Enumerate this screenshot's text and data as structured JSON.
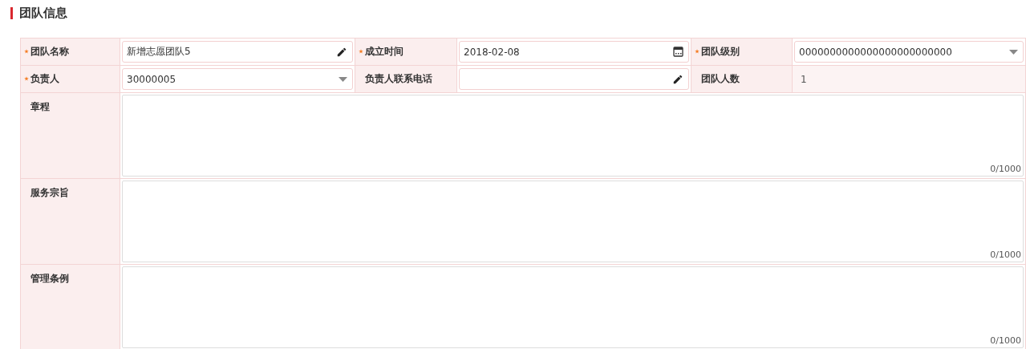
{
  "section_title": "团队信息",
  "rows": [
    [
      {
        "label": "团队名称",
        "required": true,
        "field": {
          "kind": "text",
          "value": "新增志愿团队5"
        }
      },
      {
        "label": "成立时间",
        "required": true,
        "field": {
          "kind": "date",
          "value": "2018-02-08"
        }
      },
      {
        "label": "团队级别",
        "required": true,
        "field": {
          "kind": "select",
          "value": "0000000000000000000000000"
        }
      }
    ],
    [
      {
        "label": "负责人",
        "required": true,
        "field": {
          "kind": "select",
          "value": "30000005"
        }
      },
      {
        "label": "负责人联系电话",
        "required": false,
        "field": {
          "kind": "text"
        }
      },
      {
        "label": "团队人数",
        "required": false,
        "field": {
          "kind": "readonly",
          "value": "1"
        }
      }
    ]
  ],
  "textareas": [
    {
      "label": "章程",
      "counter": "0/1000"
    },
    {
      "label": "服务宗旨",
      "counter": "0/1000"
    },
    {
      "label": "管理条例",
      "counter": "0/1000"
    }
  ]
}
